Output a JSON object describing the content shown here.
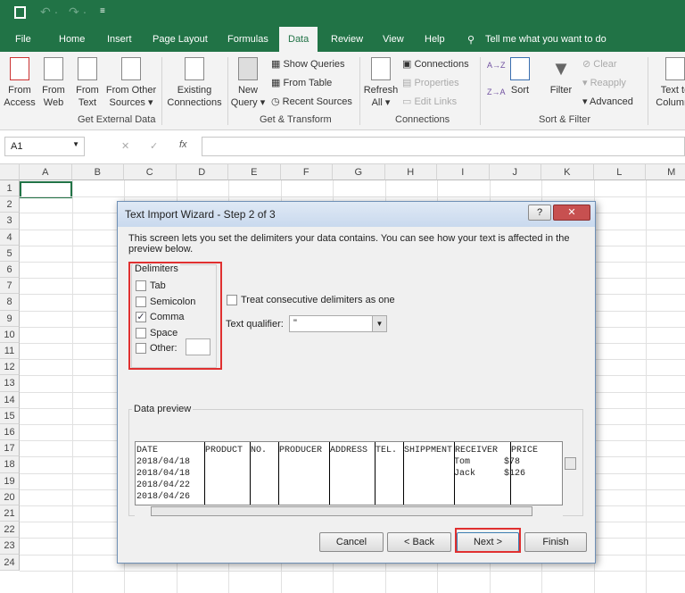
{
  "qat": {
    "save": "save-icon",
    "undo": "undo-icon",
    "redo": "redo-icon",
    "customize": "customize-icon"
  },
  "tabs": [
    "File",
    "Home",
    "Insert",
    "Page Layout",
    "Formulas",
    "Data",
    "Review",
    "View",
    "Help"
  ],
  "active_tab": "Data",
  "tell_me": "Tell me what you want to do",
  "ribbon": {
    "from_access": "From Access",
    "from_web": "From Web",
    "from_text": "From Text",
    "from_other": "From Other Sources ▾",
    "existing": "Existing Connections",
    "get_external": "Get External Data",
    "new_query": "New Query ▾",
    "show_queries": "Show Queries",
    "from_table": "From Table",
    "recent_sources": "Recent Sources",
    "get_transform": "Get & Transform",
    "refresh_all": "Refresh All ▾",
    "connections": "Connections",
    "properties": "Properties",
    "edit_links": "Edit Links",
    "connections_group": "Connections",
    "sort_az": "A→Z",
    "sort_za": "Z→A",
    "sort": "Sort",
    "filter": "Filter",
    "clear": "Clear",
    "reapply": "Reapply",
    "advanced": "Advanced",
    "sort_filter": "Sort & Filter",
    "text_to_columns": "Text to Columns"
  },
  "namebox": "A1",
  "fx": "fx",
  "columns": [
    "A",
    "B",
    "C",
    "D",
    "E",
    "F",
    "G",
    "H",
    "I",
    "J",
    "K",
    "L",
    "M"
  ],
  "rows": [
    "1",
    "2",
    "3",
    "4",
    "5",
    "6",
    "7",
    "8",
    "9",
    "10",
    "11",
    "12",
    "13",
    "14",
    "15",
    "16",
    "17",
    "18",
    "19",
    "20",
    "21",
    "22",
    "23",
    "24"
  ],
  "dialog": {
    "title": "Text Import Wizard - Step 2 of 3",
    "help": "?",
    "close": "✕",
    "intro": "This screen lets you set the delimiters your data contains.  You can see how your text is affected in the preview below.",
    "delimiters_label": "Delimiters",
    "delimiters": [
      {
        "label": "Tab",
        "checked": false
      },
      {
        "label": "Semicolon",
        "checked": false
      },
      {
        "label": "Comma",
        "checked": true
      },
      {
        "label": "Space",
        "checked": false
      },
      {
        "label": "Other:",
        "checked": false
      }
    ],
    "consecutive": "Treat consecutive delimiters as one",
    "consecutive_checked": false,
    "qualifier_label": "Text qualifier:",
    "qualifier_value": "\"",
    "preview_label": "Data preview",
    "preview_headers": [
      "DATE",
      "PRODUCT",
      "NO.",
      "PRODUCER",
      "ADDRESS",
      "TEL.",
      "SHIPPMENT",
      "RECEIVER",
      "PRICE"
    ],
    "preview_rows": [
      [
        "2018/04/18",
        "Tom",
        "$78"
      ],
      [
        "2018/04/18",
        "Jack",
        "$126"
      ],
      [
        "2018/04/22",
        "",
        ""
      ],
      [
        "2018/04/26",
        "",
        ""
      ]
    ],
    "buttons": {
      "cancel": "Cancel",
      "back": "< Back",
      "next": "Next >",
      "finish": "Finish"
    },
    "highlight_color": "#e03030"
  }
}
